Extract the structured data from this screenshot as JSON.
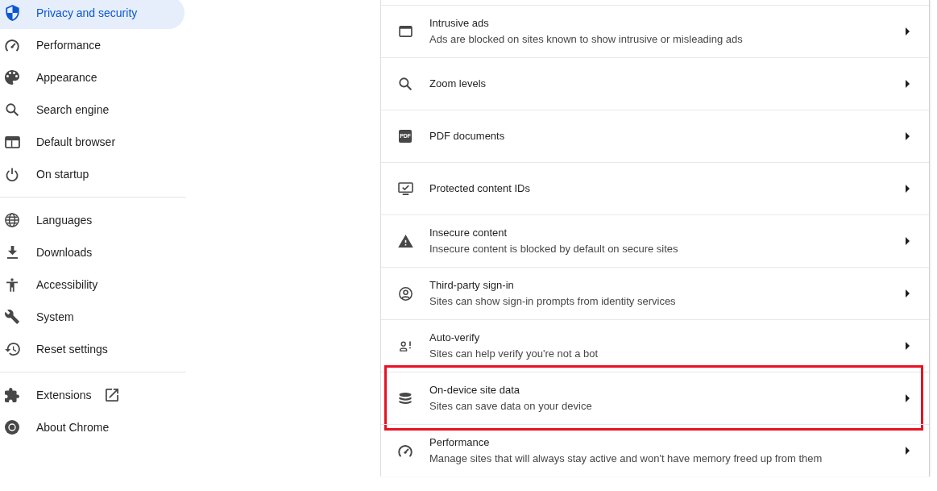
{
  "sidebar": {
    "sections": [
      {
        "items": [
          {
            "label": "Privacy and security",
            "kind": "page",
            "selected": true
          },
          {
            "label": "Performance",
            "kind": "page",
            "selected": false
          },
          {
            "label": "Appearance",
            "kind": "page",
            "selected": false
          },
          {
            "label": "Search engine",
            "kind": "page",
            "selected": false
          },
          {
            "label": "Default browser",
            "kind": "page",
            "selected": false
          },
          {
            "label": "On startup",
            "kind": "page",
            "selected": false
          }
        ]
      },
      {
        "items": [
          {
            "label": "Languages",
            "kind": "page",
            "selected": false
          },
          {
            "label": "Downloads",
            "kind": "page",
            "selected": false
          },
          {
            "label": "Accessibility",
            "kind": "page",
            "selected": false
          },
          {
            "label": "System",
            "kind": "page",
            "selected": false
          },
          {
            "label": "Reset settings",
            "kind": "page",
            "selected": false
          }
        ]
      },
      {
        "items": [
          {
            "label": "Extensions",
            "kind": "external",
            "selected": false
          },
          {
            "label": "About Chrome",
            "kind": "page",
            "selected": false
          }
        ]
      }
    ]
  },
  "settings_list": {
    "rows": [
      {
        "title": "Intrusive ads",
        "subtitle": "Ads are blocked on sites known to show intrusive or misleading ads",
        "highlighted": false
      },
      {
        "title": "Zoom levels",
        "highlighted": false
      },
      {
        "title": "PDF documents",
        "icon_label": "PDF",
        "highlighted": false
      },
      {
        "title": "Protected content IDs",
        "highlighted": false
      },
      {
        "title": "Insecure content",
        "subtitle": "Insecure content is blocked by default on secure sites",
        "highlighted": false
      },
      {
        "title": "Third-party sign-in",
        "subtitle": "Sites can show sign-in prompts from identity services",
        "highlighted": false
      },
      {
        "title": "Auto-verify",
        "subtitle": "Sites can help verify you're not a bot",
        "highlighted": false
      },
      {
        "title": "On-device site data",
        "subtitle": "Sites can save data on your device",
        "highlighted": true
      },
      {
        "title": "Performance",
        "subtitle": "Manage sites that will always stay active and won't have memory freed up from them",
        "highlighted": false
      }
    ]
  }
}
